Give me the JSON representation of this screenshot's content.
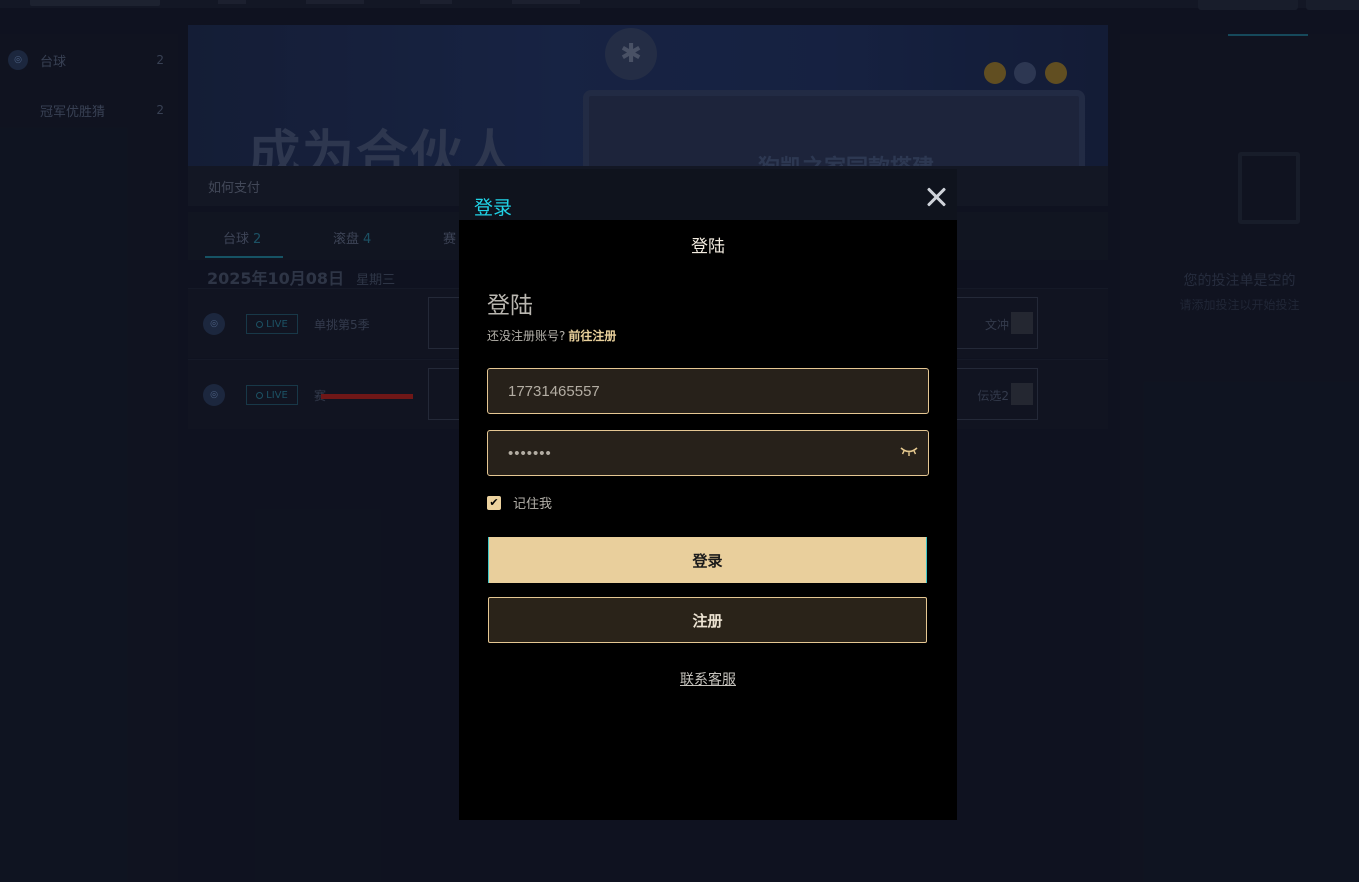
{
  "sidebar": {
    "items": [
      {
        "label": "台球",
        "count": "2"
      },
      {
        "label": "冠军优胜猜",
        "count": "2"
      }
    ]
  },
  "banner": {
    "headline": "成为合伙人",
    "screen_text": "狗凯之家园款搭建"
  },
  "notice": {
    "text": "如何支付"
  },
  "sport_tabs": [
    {
      "label": "台球",
      "count": "2"
    },
    {
      "label": "滚盘",
      "count": "4"
    },
    {
      "label": "赛",
      "count": ""
    }
  ],
  "date_header": {
    "date": "2025年10月08日",
    "weekday": "星期三"
  },
  "matches": [
    {
      "live_label": "LIVE",
      "title": "单挑第5季",
      "right_player": "文冲"
    },
    {
      "live_label": "LIVE",
      "title": "赛",
      "right_player": "伝选2"
    }
  ],
  "bet_slip": {
    "empty_title": "您的投注单是空的",
    "empty_subtitle": "请添加投注以开始投注"
  },
  "login_modal": {
    "header_title": "登录",
    "center_title": "登陆",
    "form_heading": "登陆",
    "no_account_text": "还没注册账号?",
    "register_link": "前往注册",
    "phone_value": "17731465557",
    "password_masked": "•••••••",
    "remember_me_label": "记住我",
    "remember_me_checked": true,
    "login_button": "登录",
    "register_button": "注册",
    "contact_support": "联系客服"
  },
  "colors": {
    "accent_cyan": "#20d3e6",
    "gold": "#e9cf9c",
    "live_teal": "#2a8ba6",
    "redaction": "#c2221a"
  },
  "icons": [
    "close-icon",
    "eye-closed-icon",
    "checkbox-checked-icon",
    "billiard-ball-icon",
    "live-dot-icon"
  ]
}
